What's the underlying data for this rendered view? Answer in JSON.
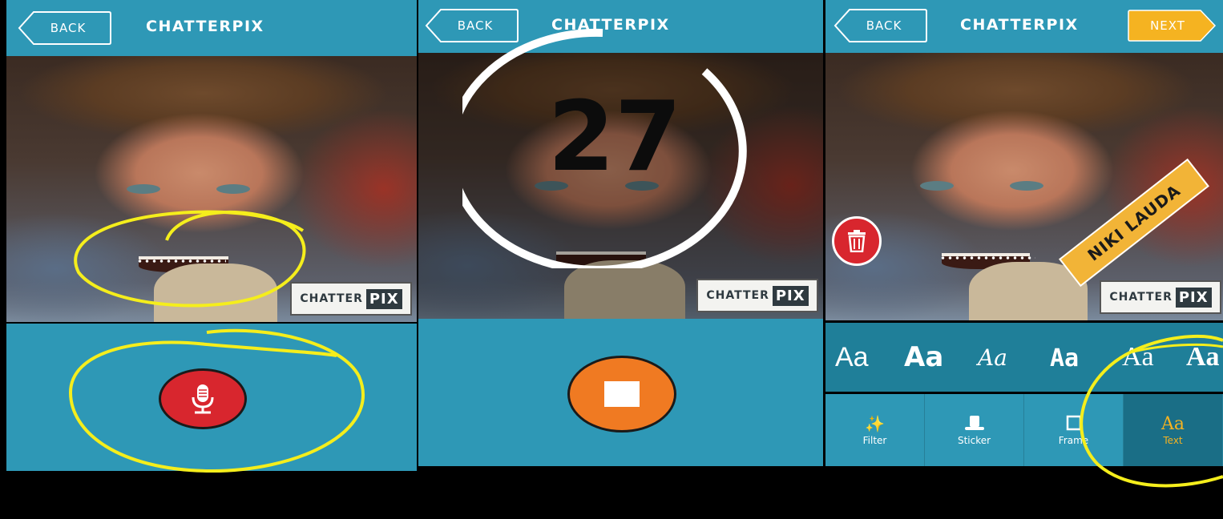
{
  "app": {
    "title": "CHATTERPIX",
    "back_label": "BACK",
    "next_label": "NEXT"
  },
  "watermark": {
    "left": "CHATTER",
    "right": "PIX"
  },
  "screen1": {
    "record_icon": "microphone-icon"
  },
  "screen2": {
    "countdown": "27",
    "stop_icon": "stop-icon"
  },
  "screen3": {
    "sticker_text": "NIKI LAUDA",
    "font_options": [
      "Aa",
      "Aa",
      "Aa",
      "Aa",
      "Aa",
      "Aa"
    ],
    "tabs": [
      {
        "label": "Filter",
        "icon": "wand-icon"
      },
      {
        "label": "Sticker",
        "icon": "hat-icon"
      },
      {
        "label": "Frame",
        "icon": "frame-icon"
      },
      {
        "label": "Text",
        "icon": "text-icon"
      }
    ],
    "active_tab": "Text"
  },
  "colors": {
    "bar": "#2e98b6",
    "record": "#d8262e",
    "stop": "#f07a22",
    "next": "#f5b321",
    "annotation": "#f5ee1c"
  }
}
